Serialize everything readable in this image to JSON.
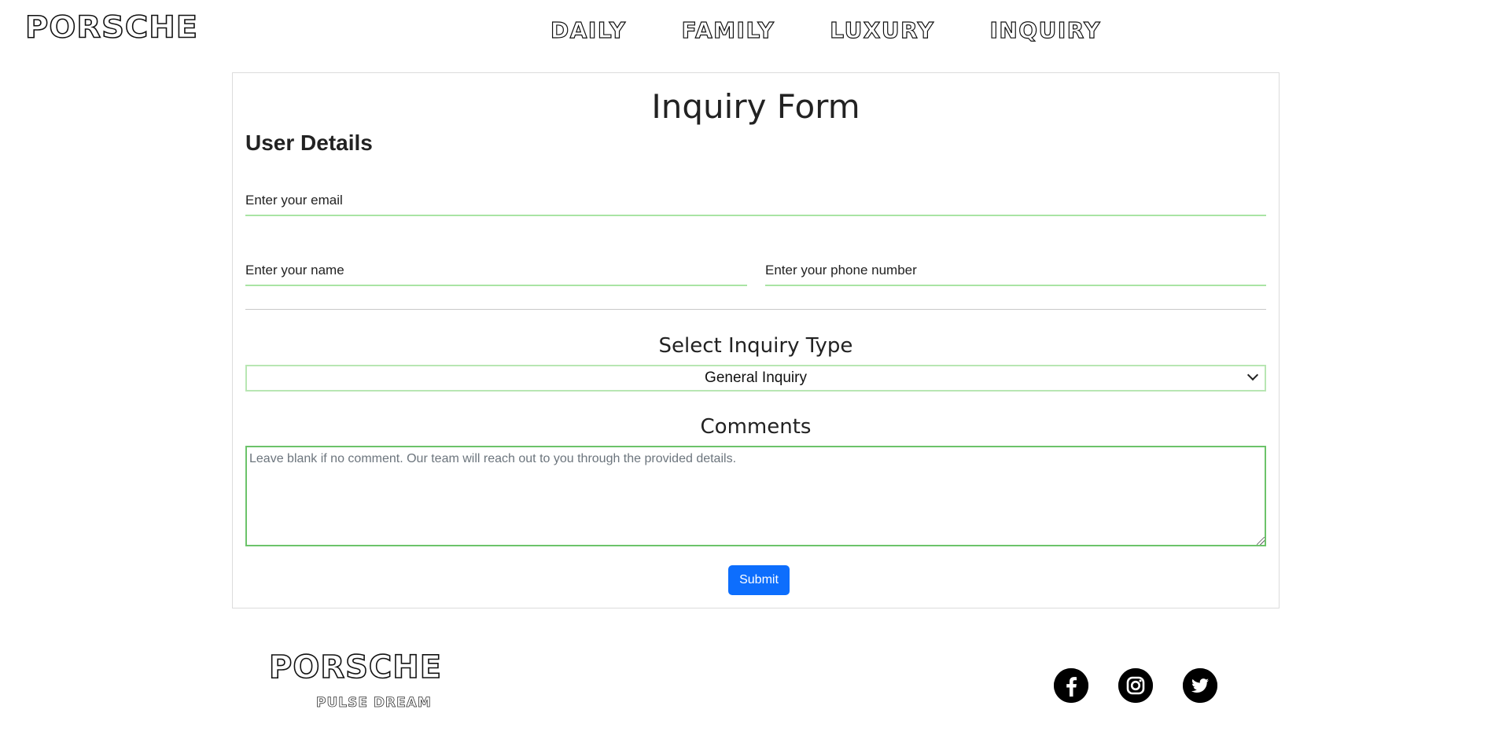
{
  "header": {
    "logo": "PORSCHE",
    "nav": [
      {
        "label": "DAILY"
      },
      {
        "label": "FAMILY"
      },
      {
        "label": "LUXURY"
      },
      {
        "label": "INQUIRY"
      }
    ]
  },
  "form": {
    "title": "Inquiry Form",
    "section_title": "User Details",
    "email_placeholder": "Enter your email",
    "name_placeholder": "Enter your name",
    "phone_placeholder": "Enter your phone number",
    "inquiry_label": "Select Inquiry Type",
    "inquiry_selected": "General Inquiry",
    "comments_label": "Comments",
    "comments_placeholder": "Leave blank if no comment. Our team will reach out to you through the provided details.",
    "submit_label": "Submit"
  },
  "footer": {
    "logo": "PORSCHE",
    "tagline": "PULSE DREAM",
    "social": [
      {
        "icon": "facebook-icon"
      },
      {
        "icon": "instagram-icon"
      },
      {
        "icon": "twitter-icon"
      }
    ]
  },
  "colors": {
    "accent_green": "#a9e4a4",
    "submit_blue": "#0d6efd"
  }
}
